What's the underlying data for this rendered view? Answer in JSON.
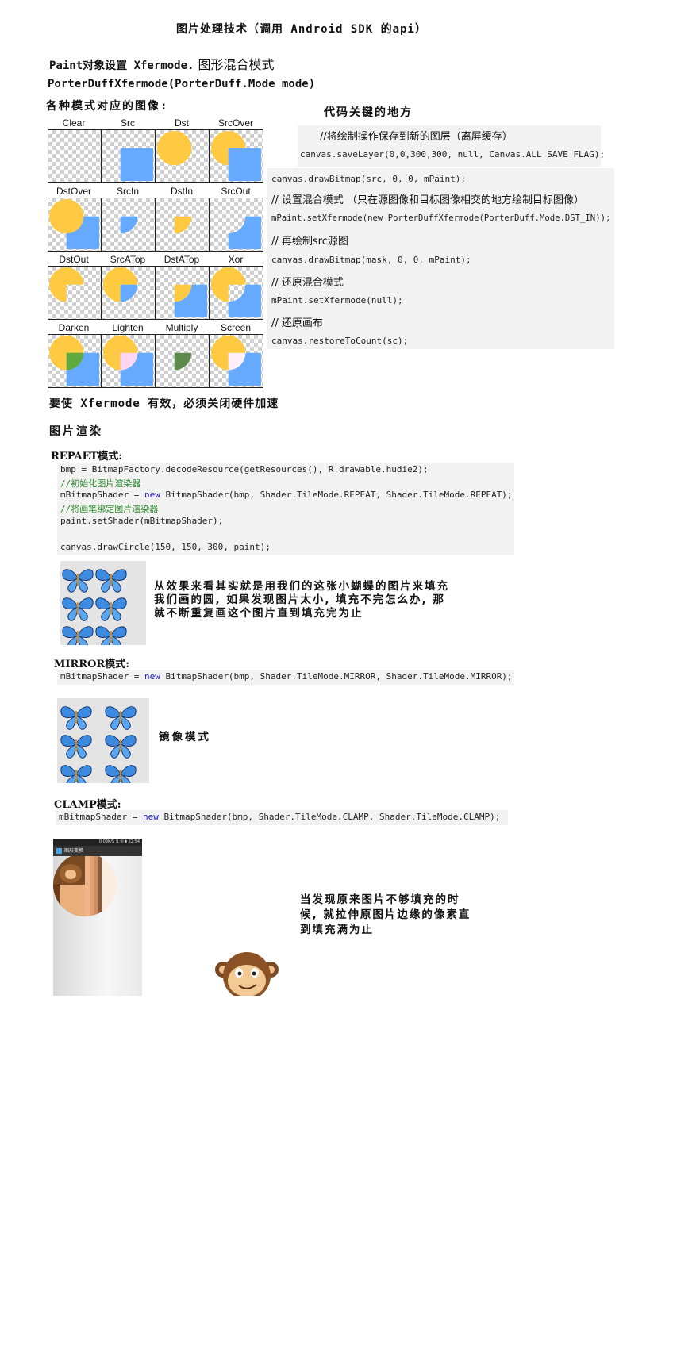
{
  "doc_title": "图片处理技术（调用 Android SDK 的api）",
  "paint_line_a": "Paint对象设置 Xfermode.",
  "paint_line_b": "图形混合模式",
  "porterduff_line": "PorterDuffXfermode(PorterDuff.Mode mode)",
  "modes_heading": "各种模式对应的图像:",
  "key_heading": "代码关键的地方",
  "modes": [
    "Clear",
    "Src",
    "Dst",
    "SrcOver",
    "DstOver",
    "SrcIn",
    "DstIn",
    "SrcOut",
    "DstOut",
    "SrcATop",
    "DstATop",
    "Xor",
    "Darken",
    "Lighten",
    "Multiply",
    "Screen"
  ],
  "key_code": {
    "comment1": "//将绘制操作保存到新的图层（离屏缓存）",
    "line1": "canvas.saveLayer(0,0,300,300, null, Canvas.ALL_SAVE_FLAG);",
    "line2": "canvas.drawBitmap(src, 0, 0, mPaint);",
    "comment2": "// 设置混合模式 （只在源图像和目标图像相交的地方绘制目标图像）",
    "line3": "mPaint.setXfermode(new PorterDuffXfermode(PorterDuff.Mode.DST_IN));",
    "comment3": "// 再绘制src源图",
    "line4": "canvas.drawBitmap(mask, 0, 0, mPaint);",
    "comment4": "// 还原混合模式",
    "line5": "mPaint.setXfermode(null);",
    "comment5": "// 还原画布",
    "line6": "canvas.restoreToCount(sc);"
  },
  "hardware_note": "要使 Xfermode 有效，必须关闭硬件加速",
  "render_heading": "图片渲染",
  "repeat": {
    "heading": "REPAET模式:",
    "l1": "bmp = BitmapFactory.decodeResource(getResources(), R.drawable.hudie2);",
    "c1": "//初始化图片渲染器",
    "l2a": "mBitmapShader = ",
    "l2kw": "new",
    "l2b": " BitmapShader(bmp, Shader.TileMode.REPEAT, Shader.TileMode.REPEAT);",
    "c2": "//将画笔绑定图片渲染器",
    "l3": "paint.setShader(mBitmapShader);",
    "l4": "canvas.drawCircle(150, 150, 300, paint);",
    "desc1": "从效果来看其实就是用我们的这张小蝴蝶的图片来填充",
    "desc2": "我们画的圆, 如果发现图片太小, 填充不完怎么办, 那",
    "desc3": "就不断重复画这个图片直到填充完为止"
  },
  "mirror": {
    "heading": "MIRROR模式:",
    "la": "mBitmapShader = ",
    "kw": "new",
    "lb": " BitmapShader(bmp, Shader.TileMode.MIRROR, Shader.TileMode.MIRROR);",
    "desc": "镜像模式"
  },
  "clamp": {
    "heading": "CLAMP模式:",
    "la": "mBitmapShader = ",
    "kw": "new",
    "lb": " BitmapShader(bmp, Shader.TileMode.CLAMP, Shader.TileMode.CLAMP);",
    "phone_title": "图形变换",
    "phone_status": "0.09K/S ⇅ ✉ ▮ 22:54",
    "desc1": "当发现原来图片不够填充的时",
    "desc2": "候, 就拉伸原图片边缘的像素直",
    "desc3": "到填充满为止"
  },
  "colors": {
    "dst_yellow": "#FFCA42",
    "src_blue": "#66AAFF",
    "darken_green": "#5FAA3F",
    "lighten_pink": "#FFD6F2",
    "multiply_green": "#5C8A4A",
    "screen_pink": "#FFEFF8"
  }
}
